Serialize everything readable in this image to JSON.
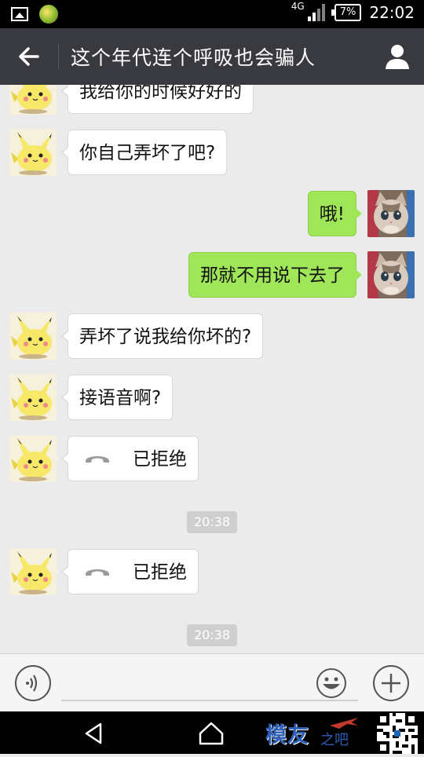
{
  "status_bar": {
    "network": "4G",
    "battery": "7%",
    "time": "22:02"
  },
  "header": {
    "title": "这个年代连个呼吸也会骗人"
  },
  "messages": [
    {
      "side": "left",
      "type": "text",
      "text": "我给你的时候好好的"
    },
    {
      "side": "left",
      "type": "text",
      "text": "你自己弄坏了吧?"
    },
    {
      "side": "right",
      "type": "text",
      "text": "哦!"
    },
    {
      "side": "right",
      "type": "text",
      "text": "那就不用说下去了"
    },
    {
      "side": "left",
      "type": "text",
      "text": "弄坏了说我给你坏的?"
    },
    {
      "side": "left",
      "type": "text",
      "text": "接语音啊?"
    },
    {
      "side": "left",
      "type": "call",
      "text": "已拒绝"
    },
    {
      "side": "center",
      "type": "timestamp",
      "text": "20:38"
    },
    {
      "side": "left",
      "type": "call",
      "text": "已拒绝"
    },
    {
      "side": "center",
      "type": "timestamp",
      "text": "20:38"
    }
  ],
  "watermark": {
    "text": "模友",
    "sub": "之吧"
  },
  "colors": {
    "header_bg": "#393a3f",
    "sent_bubble": "#9fe658",
    "received_bubble": "#ffffff",
    "chat_bg": "#ebebeb"
  }
}
